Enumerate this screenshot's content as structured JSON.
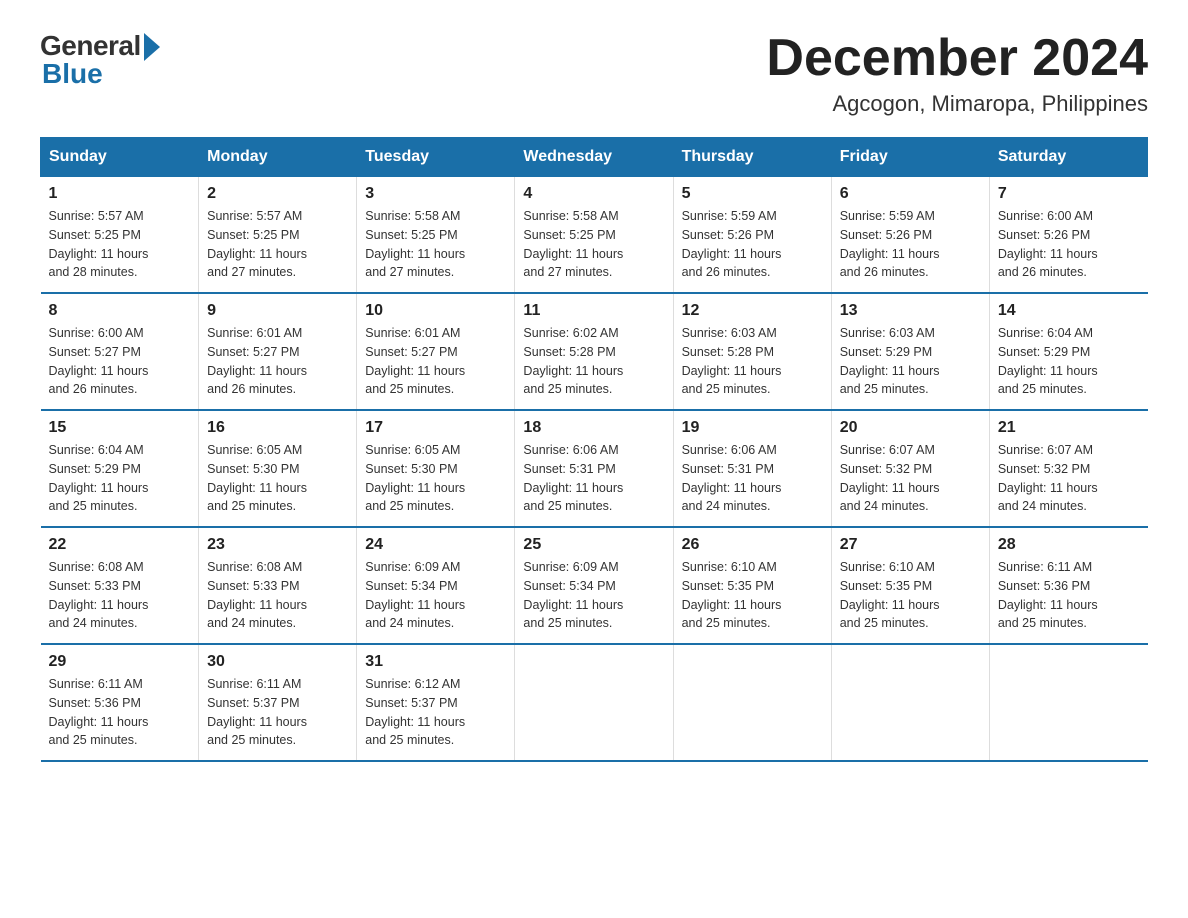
{
  "logo": {
    "general": "General",
    "blue": "Blue"
  },
  "title": "December 2024",
  "location": "Agcogon, Mimaropa, Philippines",
  "days_of_week": [
    "Sunday",
    "Monday",
    "Tuesday",
    "Wednesday",
    "Thursday",
    "Friday",
    "Saturday"
  ],
  "weeks": [
    [
      {
        "day": "1",
        "info": "Sunrise: 5:57 AM\nSunset: 5:25 PM\nDaylight: 11 hours\nand 28 minutes."
      },
      {
        "day": "2",
        "info": "Sunrise: 5:57 AM\nSunset: 5:25 PM\nDaylight: 11 hours\nand 27 minutes."
      },
      {
        "day": "3",
        "info": "Sunrise: 5:58 AM\nSunset: 5:25 PM\nDaylight: 11 hours\nand 27 minutes."
      },
      {
        "day": "4",
        "info": "Sunrise: 5:58 AM\nSunset: 5:25 PM\nDaylight: 11 hours\nand 27 minutes."
      },
      {
        "day": "5",
        "info": "Sunrise: 5:59 AM\nSunset: 5:26 PM\nDaylight: 11 hours\nand 26 minutes."
      },
      {
        "day": "6",
        "info": "Sunrise: 5:59 AM\nSunset: 5:26 PM\nDaylight: 11 hours\nand 26 minutes."
      },
      {
        "day": "7",
        "info": "Sunrise: 6:00 AM\nSunset: 5:26 PM\nDaylight: 11 hours\nand 26 minutes."
      }
    ],
    [
      {
        "day": "8",
        "info": "Sunrise: 6:00 AM\nSunset: 5:27 PM\nDaylight: 11 hours\nand 26 minutes."
      },
      {
        "day": "9",
        "info": "Sunrise: 6:01 AM\nSunset: 5:27 PM\nDaylight: 11 hours\nand 26 minutes."
      },
      {
        "day": "10",
        "info": "Sunrise: 6:01 AM\nSunset: 5:27 PM\nDaylight: 11 hours\nand 25 minutes."
      },
      {
        "day": "11",
        "info": "Sunrise: 6:02 AM\nSunset: 5:28 PM\nDaylight: 11 hours\nand 25 minutes."
      },
      {
        "day": "12",
        "info": "Sunrise: 6:03 AM\nSunset: 5:28 PM\nDaylight: 11 hours\nand 25 minutes."
      },
      {
        "day": "13",
        "info": "Sunrise: 6:03 AM\nSunset: 5:29 PM\nDaylight: 11 hours\nand 25 minutes."
      },
      {
        "day": "14",
        "info": "Sunrise: 6:04 AM\nSunset: 5:29 PM\nDaylight: 11 hours\nand 25 minutes."
      }
    ],
    [
      {
        "day": "15",
        "info": "Sunrise: 6:04 AM\nSunset: 5:29 PM\nDaylight: 11 hours\nand 25 minutes."
      },
      {
        "day": "16",
        "info": "Sunrise: 6:05 AM\nSunset: 5:30 PM\nDaylight: 11 hours\nand 25 minutes."
      },
      {
        "day": "17",
        "info": "Sunrise: 6:05 AM\nSunset: 5:30 PM\nDaylight: 11 hours\nand 25 minutes."
      },
      {
        "day": "18",
        "info": "Sunrise: 6:06 AM\nSunset: 5:31 PM\nDaylight: 11 hours\nand 25 minutes."
      },
      {
        "day": "19",
        "info": "Sunrise: 6:06 AM\nSunset: 5:31 PM\nDaylight: 11 hours\nand 24 minutes."
      },
      {
        "day": "20",
        "info": "Sunrise: 6:07 AM\nSunset: 5:32 PM\nDaylight: 11 hours\nand 24 minutes."
      },
      {
        "day": "21",
        "info": "Sunrise: 6:07 AM\nSunset: 5:32 PM\nDaylight: 11 hours\nand 24 minutes."
      }
    ],
    [
      {
        "day": "22",
        "info": "Sunrise: 6:08 AM\nSunset: 5:33 PM\nDaylight: 11 hours\nand 24 minutes."
      },
      {
        "day": "23",
        "info": "Sunrise: 6:08 AM\nSunset: 5:33 PM\nDaylight: 11 hours\nand 24 minutes."
      },
      {
        "day": "24",
        "info": "Sunrise: 6:09 AM\nSunset: 5:34 PM\nDaylight: 11 hours\nand 24 minutes."
      },
      {
        "day": "25",
        "info": "Sunrise: 6:09 AM\nSunset: 5:34 PM\nDaylight: 11 hours\nand 25 minutes."
      },
      {
        "day": "26",
        "info": "Sunrise: 6:10 AM\nSunset: 5:35 PM\nDaylight: 11 hours\nand 25 minutes."
      },
      {
        "day": "27",
        "info": "Sunrise: 6:10 AM\nSunset: 5:35 PM\nDaylight: 11 hours\nand 25 minutes."
      },
      {
        "day": "28",
        "info": "Sunrise: 6:11 AM\nSunset: 5:36 PM\nDaylight: 11 hours\nand 25 minutes."
      }
    ],
    [
      {
        "day": "29",
        "info": "Sunrise: 6:11 AM\nSunset: 5:36 PM\nDaylight: 11 hours\nand 25 minutes."
      },
      {
        "day": "30",
        "info": "Sunrise: 6:11 AM\nSunset: 5:37 PM\nDaylight: 11 hours\nand 25 minutes."
      },
      {
        "day": "31",
        "info": "Sunrise: 6:12 AM\nSunset: 5:37 PM\nDaylight: 11 hours\nand 25 minutes."
      },
      {
        "day": "",
        "info": ""
      },
      {
        "day": "",
        "info": ""
      },
      {
        "day": "",
        "info": ""
      },
      {
        "day": "",
        "info": ""
      }
    ]
  ]
}
